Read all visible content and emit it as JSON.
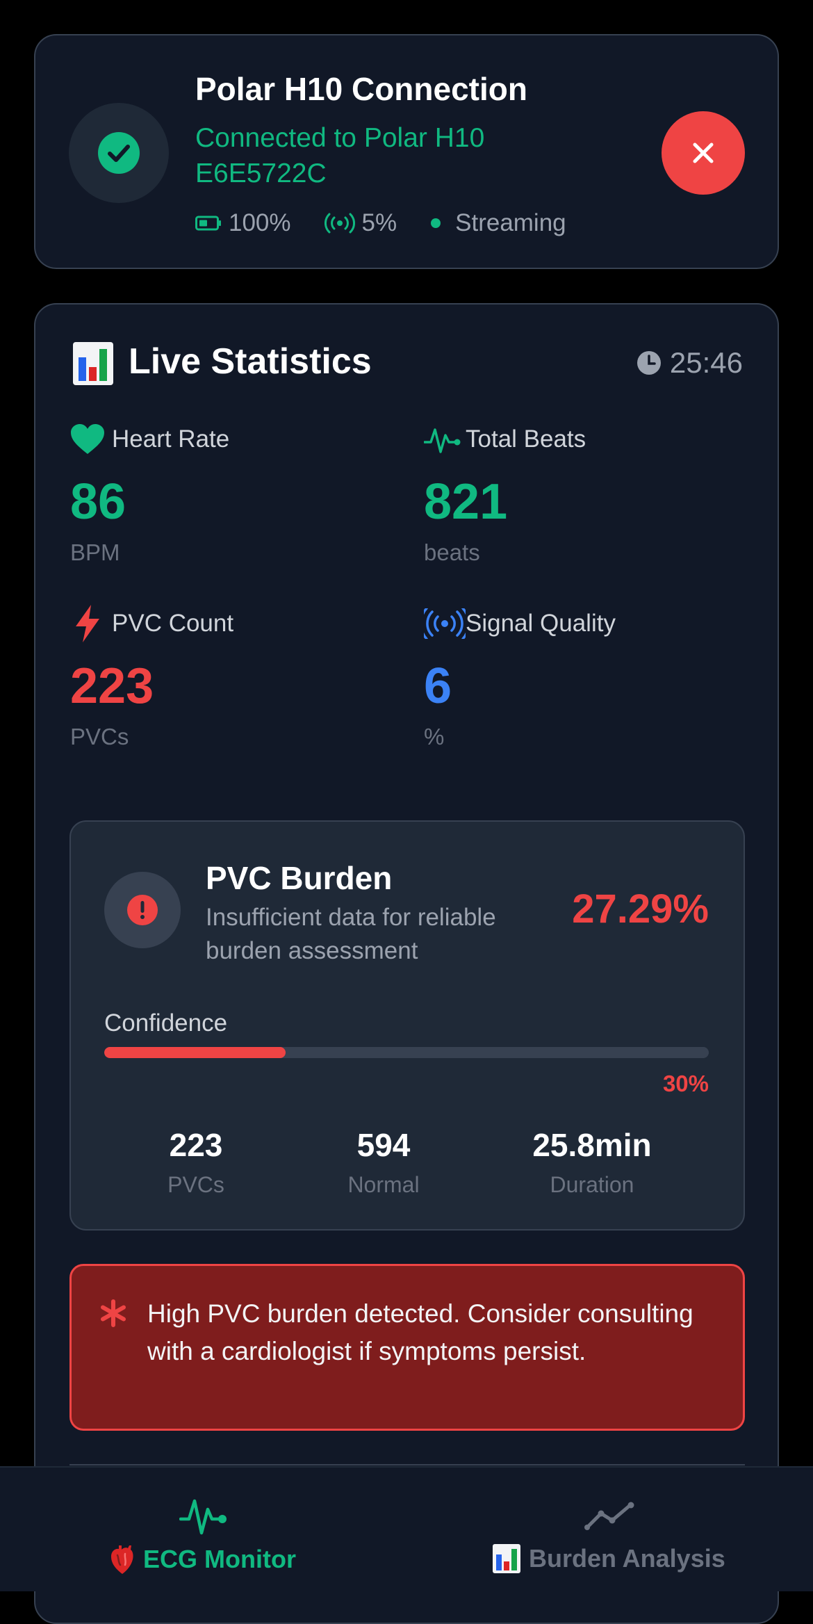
{
  "connection": {
    "title": "Polar H10 Connection",
    "status_text": "Connected to Polar H10 E6E5722C",
    "battery": "100%",
    "signal": "5%",
    "stream_state": "Streaming",
    "status_icon": "check-circle-icon",
    "disconnect_icon": "close-icon"
  },
  "stats": {
    "title": "Live Statistics",
    "elapsed": "25:46",
    "heart_rate": {
      "label": "Heart Rate",
      "value": "86",
      "unit": "BPM",
      "icon": "heart-icon"
    },
    "total_beats": {
      "label": "Total Beats",
      "value": "821",
      "unit": "beats",
      "icon": "pulse-icon"
    },
    "pvc_count": {
      "label": "PVC Count",
      "value": "223",
      "unit": "PVCs",
      "icon": "bolt-icon"
    },
    "signal_quality": {
      "label": "Signal Quality",
      "value": "6",
      "unit": "%",
      "icon": "signal-icon"
    }
  },
  "burden": {
    "title": "PVC Burden",
    "description": "Insufficient data for reliable burden assessment",
    "percentage": "27.29%",
    "confidence_label": "Confidence",
    "confidence_value": "30%",
    "confidence_fraction": 0.3,
    "pvcs": {
      "value": "223",
      "label": "PVCs"
    },
    "normal": {
      "value": "594",
      "label": "Normal"
    },
    "duration": {
      "value": "25.8min",
      "label": "Duration"
    }
  },
  "alert": {
    "message": "High PVC burden detected. Consider consulting with a cardiologist if symptoms persist.",
    "icon": "asterisk-icon"
  },
  "nav": {
    "tabs": [
      {
        "label": "ECG Monitor",
        "icon": "pulse-icon",
        "emoji": "anatomical-heart-icon",
        "active": true
      },
      {
        "label": "Burden Analysis",
        "icon": "trend-line-icon",
        "emoji": "bar-chart-icon",
        "active": false
      }
    ]
  },
  "colors": {
    "background": "#000000",
    "card": "#111827",
    "panel": "#1f2937",
    "green": "#10b981",
    "red": "#ef4444",
    "blue": "#3b82f6",
    "muted": "#9ca3af",
    "alert_bg": "#7f1d1d"
  }
}
